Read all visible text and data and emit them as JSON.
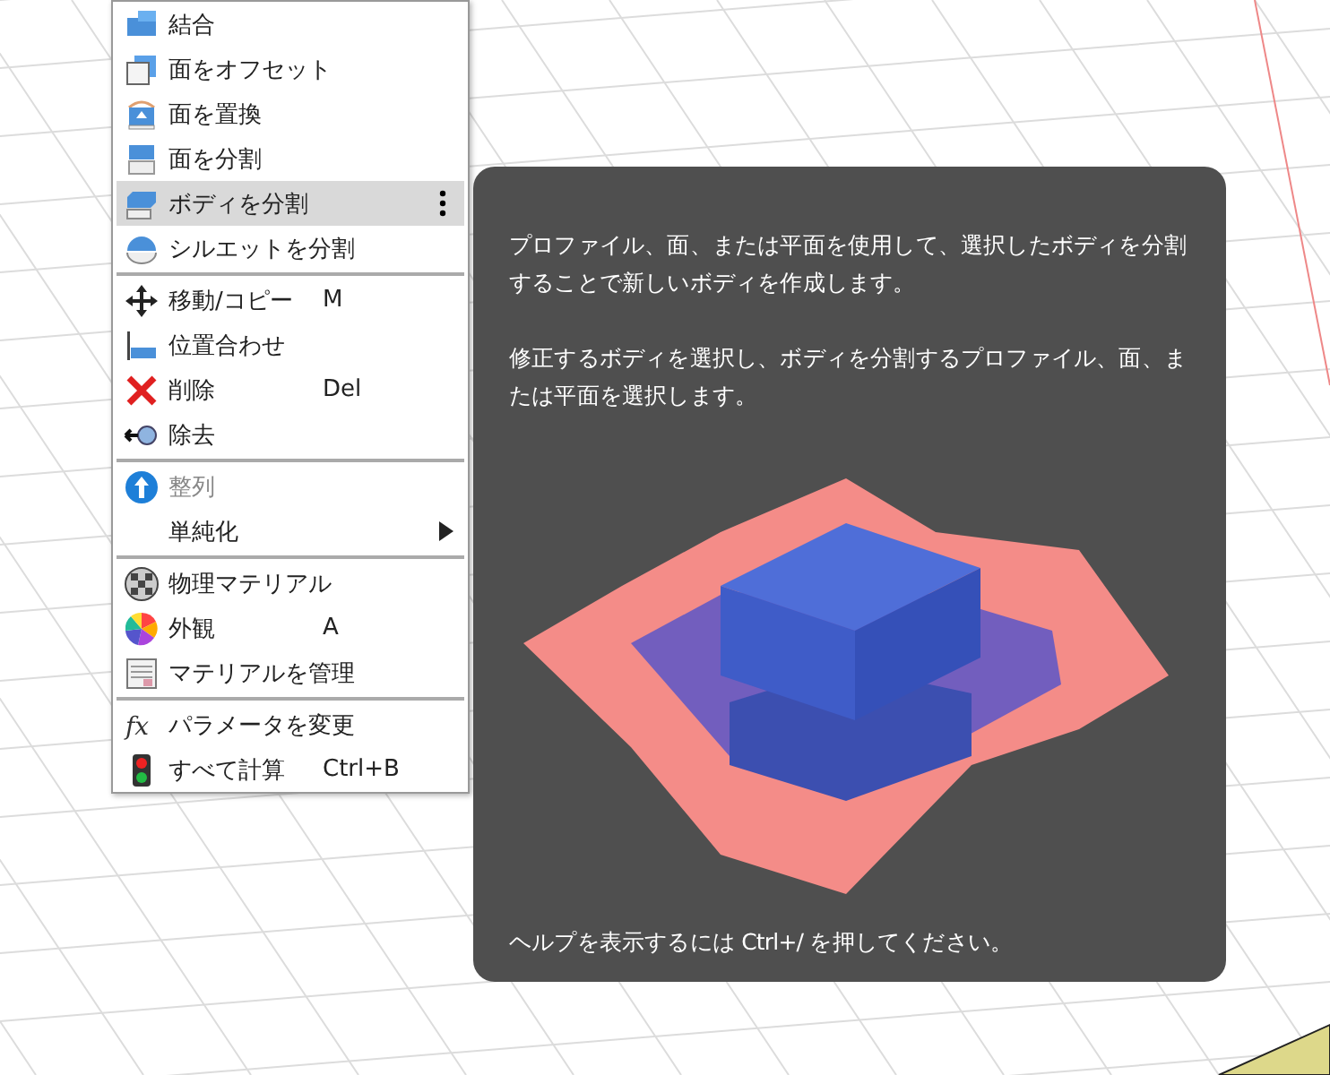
{
  "menu": {
    "groups": [
      [
        {
          "kind": "combine",
          "label": "結合",
          "selected": false,
          "disabled": false
        },
        {
          "kind": "offset",
          "label": "面をオフセット",
          "selected": false,
          "disabled": false
        },
        {
          "kind": "replace",
          "label": "面を置換",
          "selected": false,
          "disabled": false
        },
        {
          "kind": "splitface",
          "label": "面を分割",
          "selected": false,
          "disabled": false
        },
        {
          "kind": "splitbody",
          "label": "ボディを分割",
          "selected": true,
          "disabled": false,
          "more": true
        },
        {
          "kind": "silhouette",
          "label": "シルエットを分割",
          "selected": false,
          "disabled": false
        }
      ],
      [
        {
          "kind": "move",
          "label": "移動/コピー",
          "shortcut": "M",
          "selected": false,
          "disabled": false
        },
        {
          "kind": "align",
          "label": "位置合わせ",
          "selected": false,
          "disabled": false
        },
        {
          "kind": "delete",
          "label": "削除",
          "shortcut": "Del",
          "selected": false,
          "disabled": false
        },
        {
          "kind": "remove",
          "label": "除去",
          "selected": false,
          "disabled": false
        }
      ],
      [
        {
          "kind": "arrange",
          "label": "整列",
          "selected": false,
          "disabled": true
        },
        {
          "kind": "none",
          "label": "単純化",
          "selected": false,
          "disabled": false,
          "submenu": true
        }
      ],
      [
        {
          "kind": "physical",
          "label": "物理マテリアル",
          "selected": false,
          "disabled": false
        },
        {
          "kind": "appearance",
          "label": "外観",
          "shortcut": "A",
          "selected": false,
          "disabled": false
        },
        {
          "kind": "manage",
          "label": "マテリアルを管理",
          "selected": false,
          "disabled": false
        }
      ],
      [
        {
          "kind": "fx",
          "label": "パラメータを変更",
          "selected": false,
          "disabled": false
        },
        {
          "kind": "compute",
          "label": "すべて計算",
          "shortcut": "Ctrl+B",
          "selected": false,
          "disabled": false
        }
      ]
    ]
  },
  "tooltip": {
    "paragraphs": [
      "プロファイル、面、または平面を使用して、選択したボディを分割することで新しいボディを作成します。",
      "修正するボディを選択し、ボディを分割するプロファイル、面、または平面を選択します。"
    ],
    "footer": "ヘルプを表示するには Ctrl+/ を押してください。"
  }
}
